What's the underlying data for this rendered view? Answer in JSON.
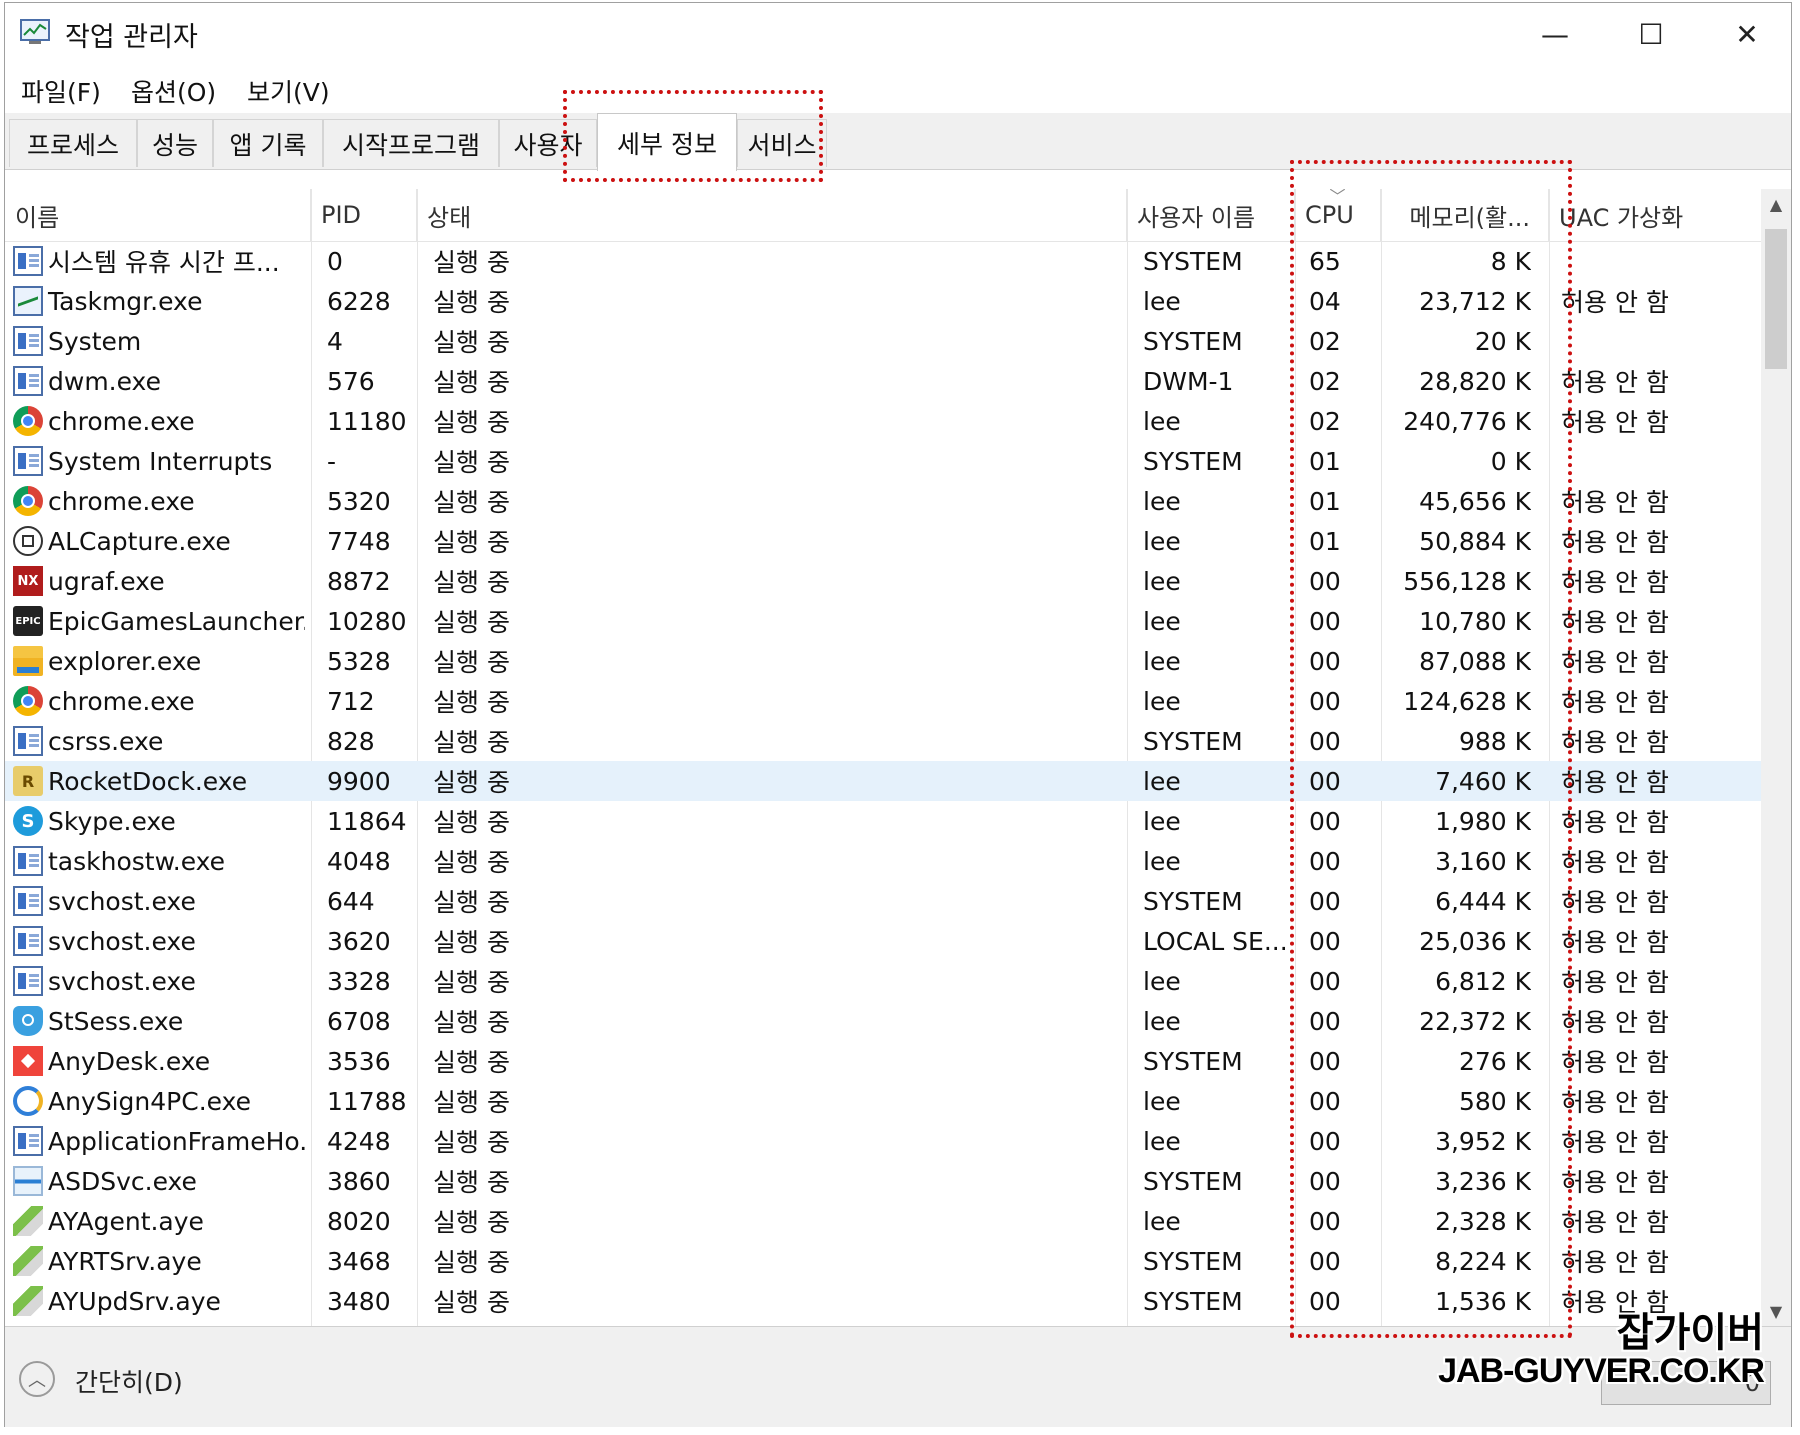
{
  "window": {
    "title": "작업 관리자",
    "min_glyph": "—",
    "max_glyph": "☐",
    "close_glyph": "✕"
  },
  "menu": [
    "파일(F)",
    "옵션(O)",
    "보기(V)"
  ],
  "tabs": [
    {
      "label": "프로세스",
      "active": false
    },
    {
      "label": "성능",
      "active": false
    },
    {
      "label": "앱 기록",
      "active": false
    },
    {
      "label": "시작프로그램",
      "active": false
    },
    {
      "label": "사용자",
      "active": false
    },
    {
      "label": "세부 정보",
      "active": true
    },
    {
      "label": "서비스",
      "active": false
    }
  ],
  "columns": [
    "이름",
    "PID",
    "상태",
    "사용자 이름",
    "CPU",
    "메모리(활...",
    "UAC 가상화"
  ],
  "rows": [
    {
      "icon": "window-icon",
      "name": "시스템 유휴 시간 프...",
      "pid": "0",
      "status": "실행 중",
      "user": "SYSTEM",
      "cpu": "65",
      "mem": "8 K",
      "uac": ""
    },
    {
      "icon": "taskmgr-icon",
      "name": "Taskmgr.exe",
      "pid": "6228",
      "status": "실행 중",
      "user": "lee",
      "cpu": "04",
      "mem": "23,712 K",
      "uac": "허용 안 함"
    },
    {
      "icon": "window-icon",
      "name": "System",
      "pid": "4",
      "status": "실행 중",
      "user": "SYSTEM",
      "cpu": "02",
      "mem": "20 K",
      "uac": ""
    },
    {
      "icon": "window-icon",
      "name": "dwm.exe",
      "pid": "576",
      "status": "실행 중",
      "user": "DWM-1",
      "cpu": "02",
      "mem": "28,820 K",
      "uac": "허용 안 함"
    },
    {
      "icon": "chrome-icon",
      "name": "chrome.exe",
      "pid": "11180",
      "status": "실행 중",
      "user": "lee",
      "cpu": "02",
      "mem": "240,776 K",
      "uac": "허용 안 함"
    },
    {
      "icon": "window-icon",
      "name": "System Interrupts",
      "pid": "-",
      "status": "실행 중",
      "user": "SYSTEM",
      "cpu": "01",
      "mem": "0 K",
      "uac": ""
    },
    {
      "icon": "chrome-icon",
      "name": "chrome.exe",
      "pid": "5320",
      "status": "실행 중",
      "user": "lee",
      "cpu": "01",
      "mem": "45,656 K",
      "uac": "허용 안 함"
    },
    {
      "icon": "capture-icon",
      "name": "ALCapture.exe",
      "pid": "7748",
      "status": "실행 중",
      "user": "lee",
      "cpu": "01",
      "mem": "50,884 K",
      "uac": "허용 안 함"
    },
    {
      "icon": "nx-icon",
      "name": "ugraf.exe",
      "pid": "8872",
      "status": "실행 중",
      "user": "lee",
      "cpu": "00",
      "mem": "556,128 K",
      "uac": "허용 안 함"
    },
    {
      "icon": "epic-icon",
      "name": "EpicGamesLauncher....",
      "pid": "10280",
      "status": "실행 중",
      "user": "lee",
      "cpu": "00",
      "mem": "10,780 K",
      "uac": "허용 안 함"
    },
    {
      "icon": "folder-icon",
      "name": "explorer.exe",
      "pid": "5328",
      "status": "실행 중",
      "user": "lee",
      "cpu": "00",
      "mem": "87,088 K",
      "uac": "허용 안 함"
    },
    {
      "icon": "chrome-icon",
      "name": "chrome.exe",
      "pid": "712",
      "status": "실행 중",
      "user": "lee",
      "cpu": "00",
      "mem": "124,628 K",
      "uac": "허용 안 함"
    },
    {
      "icon": "window-icon",
      "name": "csrss.exe",
      "pid": "828",
      "status": "실행 중",
      "user": "SYSTEM",
      "cpu": "00",
      "mem": "988 K",
      "uac": "허용 안 함"
    },
    {
      "icon": "rocketdock-icon",
      "name": "RocketDock.exe",
      "pid": "9900",
      "status": "실행 중",
      "user": "lee",
      "cpu": "00",
      "mem": "7,460 K",
      "uac": "허용 안 함",
      "selected": true
    },
    {
      "icon": "skype-icon",
      "name": "Skype.exe",
      "pid": "11864",
      "status": "실행 중",
      "user": "lee",
      "cpu": "00",
      "mem": "1,980 K",
      "uac": "허용 안 함"
    },
    {
      "icon": "window-icon",
      "name": "taskhostw.exe",
      "pid": "4048",
      "status": "실행 중",
      "user": "lee",
      "cpu": "00",
      "mem": "3,160 K",
      "uac": "허용 안 함"
    },
    {
      "icon": "window-icon",
      "name": "svchost.exe",
      "pid": "644",
      "status": "실행 중",
      "user": "SYSTEM",
      "cpu": "00",
      "mem": "6,444 K",
      "uac": "허용 안 함"
    },
    {
      "icon": "window-icon",
      "name": "svchost.exe",
      "pid": "3620",
      "status": "실행 중",
      "user": "LOCAL SE...",
      "cpu": "00",
      "mem": "25,036 K",
      "uac": "허용 안 함"
    },
    {
      "icon": "window-icon",
      "name": "svchost.exe",
      "pid": "3328",
      "status": "실행 중",
      "user": "lee",
      "cpu": "00",
      "mem": "6,812 K",
      "uac": "허용 안 함"
    },
    {
      "icon": "shield-icon",
      "name": "StSess.exe",
      "pid": "6708",
      "status": "실행 중",
      "user": "lee",
      "cpu": "00",
      "mem": "22,372 K",
      "uac": "허용 안 함"
    },
    {
      "icon": "anydesk-icon",
      "name": "AnyDesk.exe",
      "pid": "3536",
      "status": "실행 중",
      "user": "SYSTEM",
      "cpu": "00",
      "mem": "276 K",
      "uac": "허용 안 함"
    },
    {
      "icon": "anysign-icon",
      "name": "AnySign4PC.exe",
      "pid": "11788",
      "status": "실행 중",
      "user": "lee",
      "cpu": "00",
      "mem": "580 K",
      "uac": "허용 안 함"
    },
    {
      "icon": "window-icon",
      "name": "ApplicationFrameHo...",
      "pid": "4248",
      "status": "실행 중",
      "user": "lee",
      "cpu": "00",
      "mem": "3,952 K",
      "uac": "허용 안 함"
    },
    {
      "icon": "asd-icon",
      "name": "ASDSvc.exe",
      "pid": "3860",
      "status": "실행 중",
      "user": "SYSTEM",
      "cpu": "00",
      "mem": "3,236 K",
      "uac": "허용 안 함"
    },
    {
      "icon": "pill-icon",
      "name": "AYAgent.aye",
      "pid": "8020",
      "status": "실행 중",
      "user": "lee",
      "cpu": "00",
      "mem": "2,328 K",
      "uac": "허용 안 함"
    },
    {
      "icon": "pill-icon",
      "name": "AYRTSrv.aye",
      "pid": "3468",
      "status": "실행 중",
      "user": "SYSTEM",
      "cpu": "00",
      "mem": "8,224 K",
      "uac": "허용 안 함"
    },
    {
      "icon": "pill-icon",
      "name": "AYUpdSrv.aye",
      "pid": "3480",
      "status": "실행 중",
      "user": "SYSTEM",
      "cpu": "00",
      "mem": "1,536 K",
      "uac": "허용 안 함"
    }
  ],
  "footer": {
    "fewer_details": "간단히(D)",
    "end_task": "0"
  },
  "watermark": {
    "line1": "잡가이버",
    "line2": "JAB-GUYVER.CO.KR"
  },
  "colors": {
    "annotation_red": "#cc1111",
    "selected_row": "#e5f1fb"
  }
}
